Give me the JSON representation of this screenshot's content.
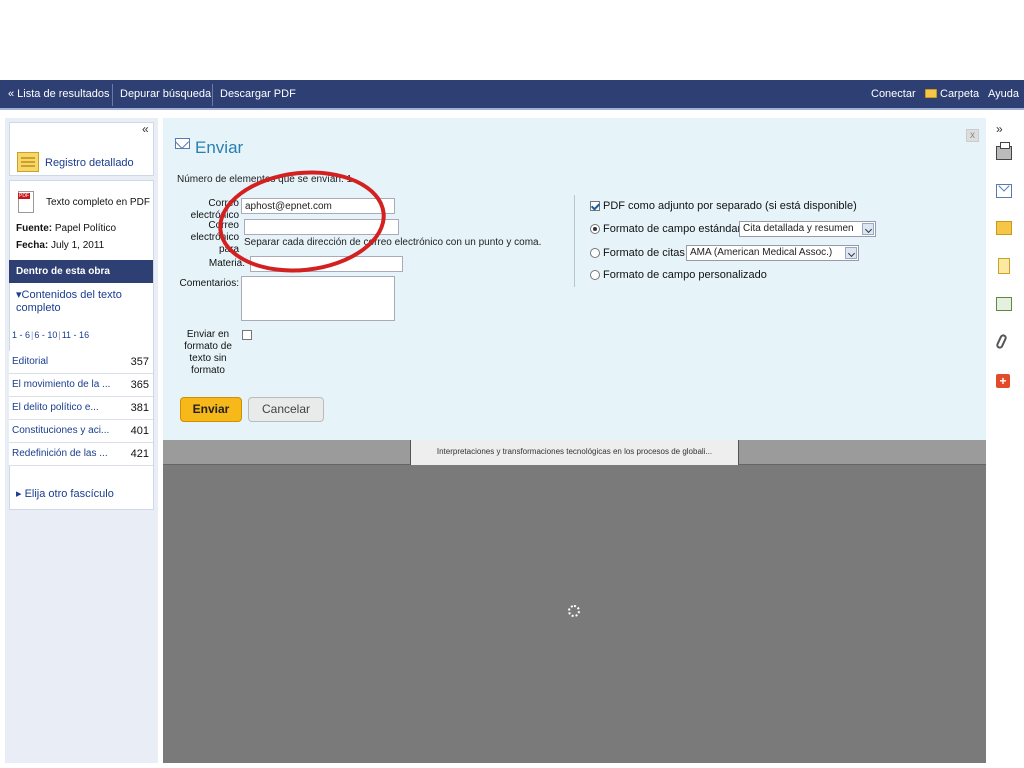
{
  "nav": {
    "back_results": "« Lista de resultados",
    "refine": "Depurar búsqueda",
    "download_pdf": "Descargar PDF",
    "connect": "Conectar",
    "folder": "Carpeta",
    "help": "Ayuda"
  },
  "sidebar": {
    "collapse": "«",
    "detailed_record": "Registro detallado",
    "full_text_pdf": "Texto completo en PDF",
    "source_label": "Fuente:",
    "source_value": "Papel Político",
    "date_label": "Fecha:",
    "date_value": "July 1, 2011",
    "within_work": "Dentro de esta obra",
    "contents": "Contenidos del texto completo",
    "pages": [
      "1 - 6",
      "6 - 10",
      "11 - 16"
    ],
    "toc": [
      {
        "title": "Editorial",
        "page": "357"
      },
      {
        "title": "El movimiento de la ...",
        "page": "365"
      },
      {
        "title": "El delito político e...",
        "page": "381"
      },
      {
        "title": "Constituciones y aci...",
        "page": "401"
      },
      {
        "title": "Redefinición de las ...",
        "page": "421"
      }
    ],
    "other_issue": "Elija otro fascículo"
  },
  "dialog": {
    "title": "Enviar",
    "close": "x",
    "count_text": "Número de elementos que se envían: 1",
    "from_label": "Correo electrónico",
    "from_value": "aphost@epnet.com",
    "to_label": "Correo electrónico para",
    "to_value": "",
    "help_text": "Separar cada dirección de correo electrónico con un punto y coma.",
    "subject_label": "Materia:",
    "subject_value": "",
    "comments_label": "Comentarios:",
    "plain_text_label": "Enviar en formato de texto sin formato",
    "pdf_attach": "PDF como adjunto por separado (si está disponible)",
    "std_format": "Formato de campo estándar",
    "std_format_value": "Cita detallada y resumen",
    "cite_format": "Formato de citas",
    "cite_format_value": "AMA (American Medical Assoc.)",
    "custom_format": "Formato de campo personalizado",
    "send_button": "Enviar",
    "cancel_button": "Cancelar"
  },
  "viewer": {
    "tab_title": "Interpretaciones y transformaciones tecnológicas en los procesos de globali..."
  },
  "righttb": {
    "expand": "»",
    "plus": "+"
  }
}
